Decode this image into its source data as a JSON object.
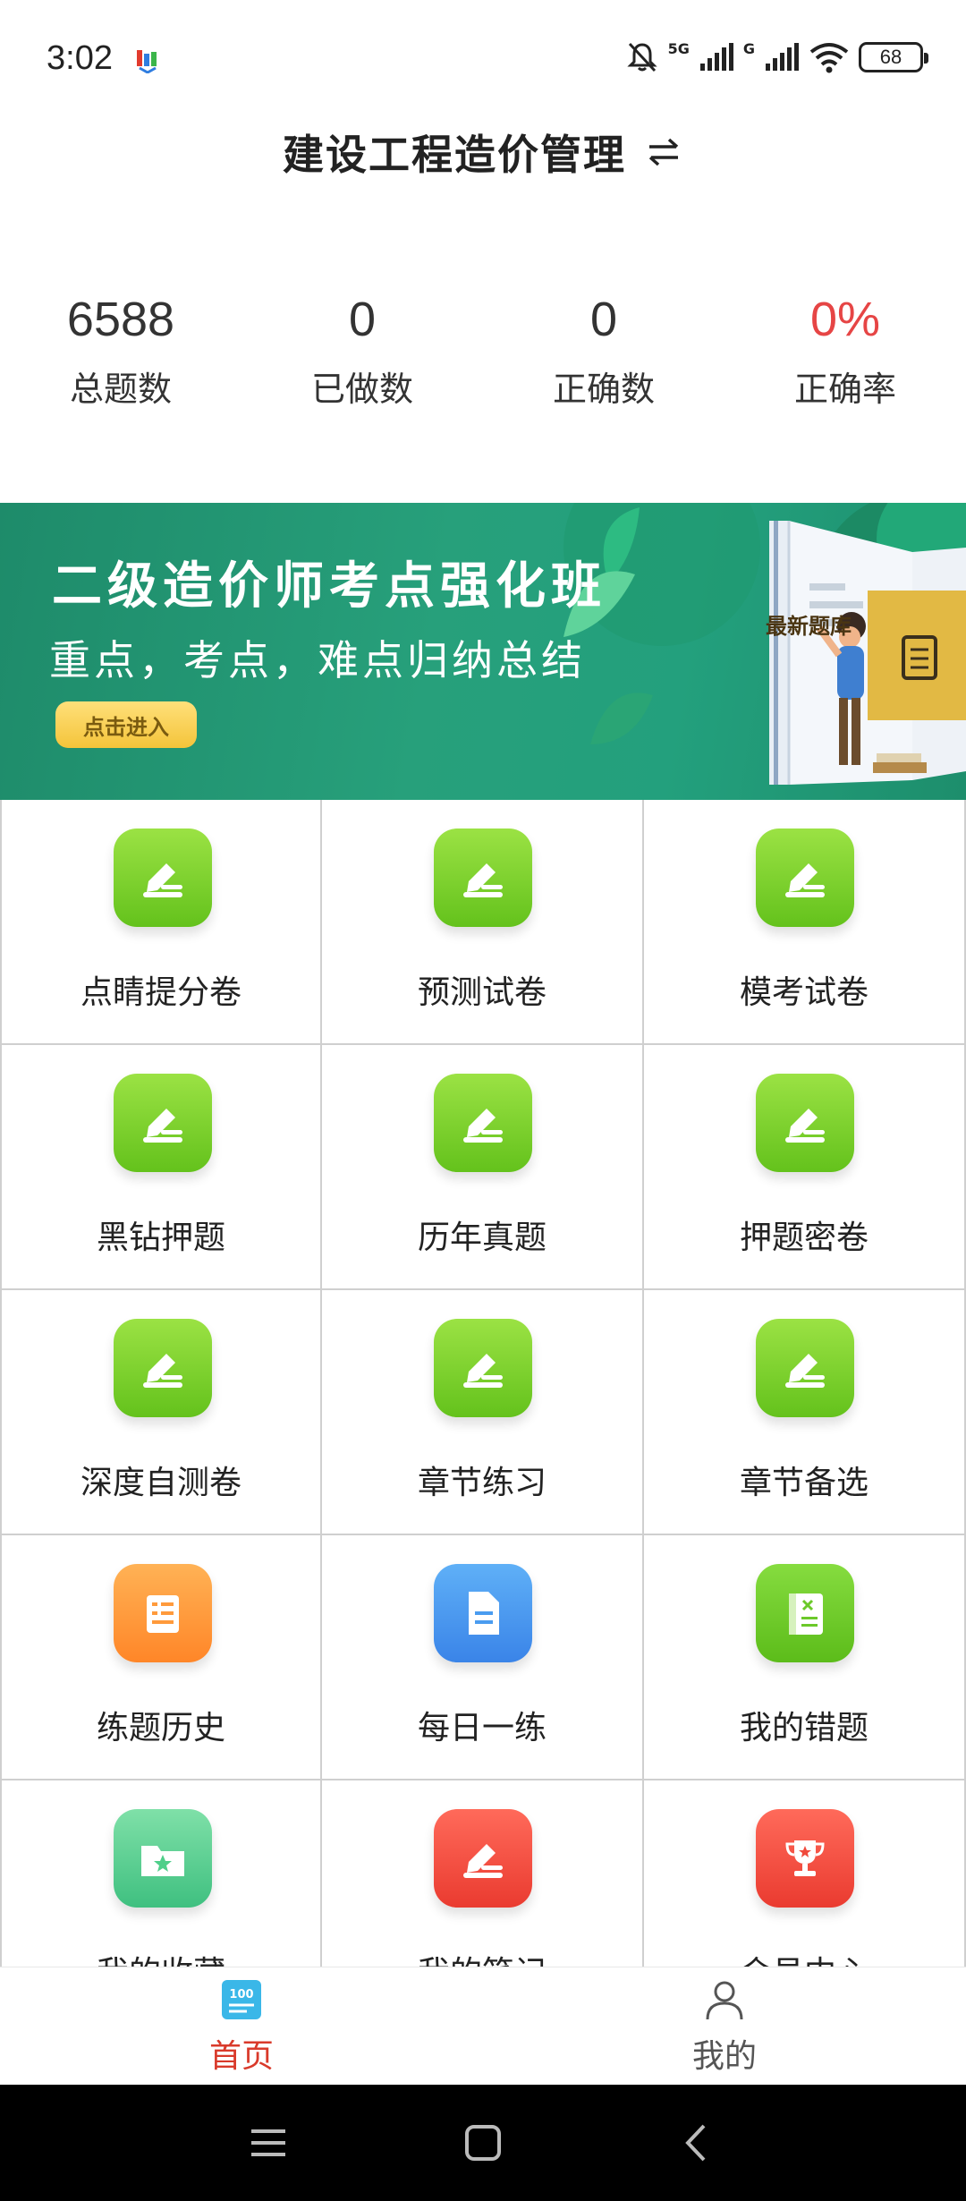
{
  "status_bar": {
    "time": "3:02",
    "net1": "5G",
    "net2": "G",
    "battery": "68"
  },
  "header": {
    "title": "建设工程造价管理",
    "switch_icon": "swap-arrows-icon"
  },
  "stats": [
    {
      "value": "6588",
      "label": "总题数"
    },
    {
      "value": "0",
      "label": "已做数"
    },
    {
      "value": "0",
      "label": "正确数"
    },
    {
      "value": "0%",
      "label": "正确率"
    }
  ],
  "banner": {
    "title": "二级造价师考点强化班",
    "subtitle": "重点，考点，难点归纳总结",
    "button": "点击进入",
    "book_label": "最新题库"
  },
  "grid": [
    {
      "label": "点睛提分卷",
      "icon": "edit-icon",
      "color": "#7ed321"
    },
    {
      "label": "预测试卷",
      "icon": "edit-icon",
      "color": "#7ed321"
    },
    {
      "label": "模考试卷",
      "icon": "edit-icon",
      "color": "#7ed321"
    },
    {
      "label": "黑钻押题",
      "icon": "edit-icon",
      "color": "#7ed321"
    },
    {
      "label": "历年真题",
      "icon": "edit-icon",
      "color": "#7ed321"
    },
    {
      "label": "押题密卷",
      "icon": "edit-icon",
      "color": "#7ed321"
    },
    {
      "label": "深度自测卷",
      "icon": "edit-icon",
      "color": "#7ed321"
    },
    {
      "label": "章节练习",
      "icon": "edit-icon",
      "color": "#7ed321"
    },
    {
      "label": "章节备选",
      "icon": "edit-icon",
      "color": "#7ed321"
    },
    {
      "label": "练题历史",
      "icon": "scroll-icon",
      "color": "#ff9a3c"
    },
    {
      "label": "每日一练",
      "icon": "document-icon",
      "color": "#4a9cf0"
    },
    {
      "label": "我的错题",
      "icon": "wrong-book-icon",
      "color": "#6cc92a"
    },
    {
      "label": "我的收藏",
      "icon": "star-folder-icon",
      "color": "#4fcf8a"
    },
    {
      "label": "我的笔记",
      "icon": "edit-icon",
      "color": "#f04a3c"
    },
    {
      "label": "会员中心",
      "icon": "trophy-icon",
      "color": "#f04a3c"
    }
  ],
  "bottom_nav": [
    {
      "label": "首页",
      "icon": "home-100-icon",
      "active": true
    },
    {
      "label": "我的",
      "icon": "person-icon",
      "active": false
    }
  ],
  "colors": {
    "accent_red": "#d93a2b",
    "stat_red": "#e64545",
    "banner_green": "#23a07d"
  }
}
